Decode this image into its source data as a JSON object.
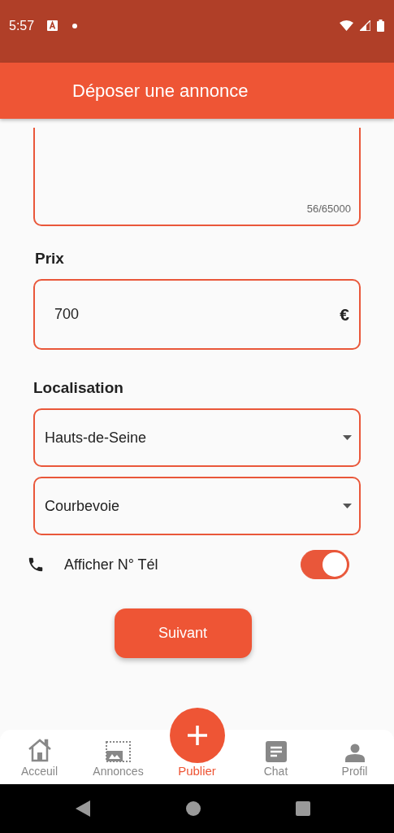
{
  "status_bar": {
    "time": "5:57"
  },
  "app_bar": {
    "title": "Déposer une annonce"
  },
  "description": {
    "counter": "56/65000"
  },
  "price": {
    "label": "Prix",
    "value": "700",
    "currency": "€"
  },
  "location": {
    "label": "Localisation",
    "fields": [
      {
        "value": "Hauts-de-Seine"
      },
      {
        "value": "Courbevoie"
      }
    ]
  },
  "phone_toggle": {
    "label": "Afficher N° Tél",
    "on": true
  },
  "next_button": "Suivant",
  "bottom_nav": [
    {
      "label": "Acceuil",
      "kind": "home",
      "selected": false
    },
    {
      "label": "Annonces",
      "kind": "gallery",
      "selected": false
    },
    {
      "label": "Publier",
      "kind": "add",
      "selected": true
    },
    {
      "label": "Chat",
      "kind": "chat",
      "selected": false
    },
    {
      "label": "Profil",
      "kind": "person",
      "selected": false
    }
  ]
}
